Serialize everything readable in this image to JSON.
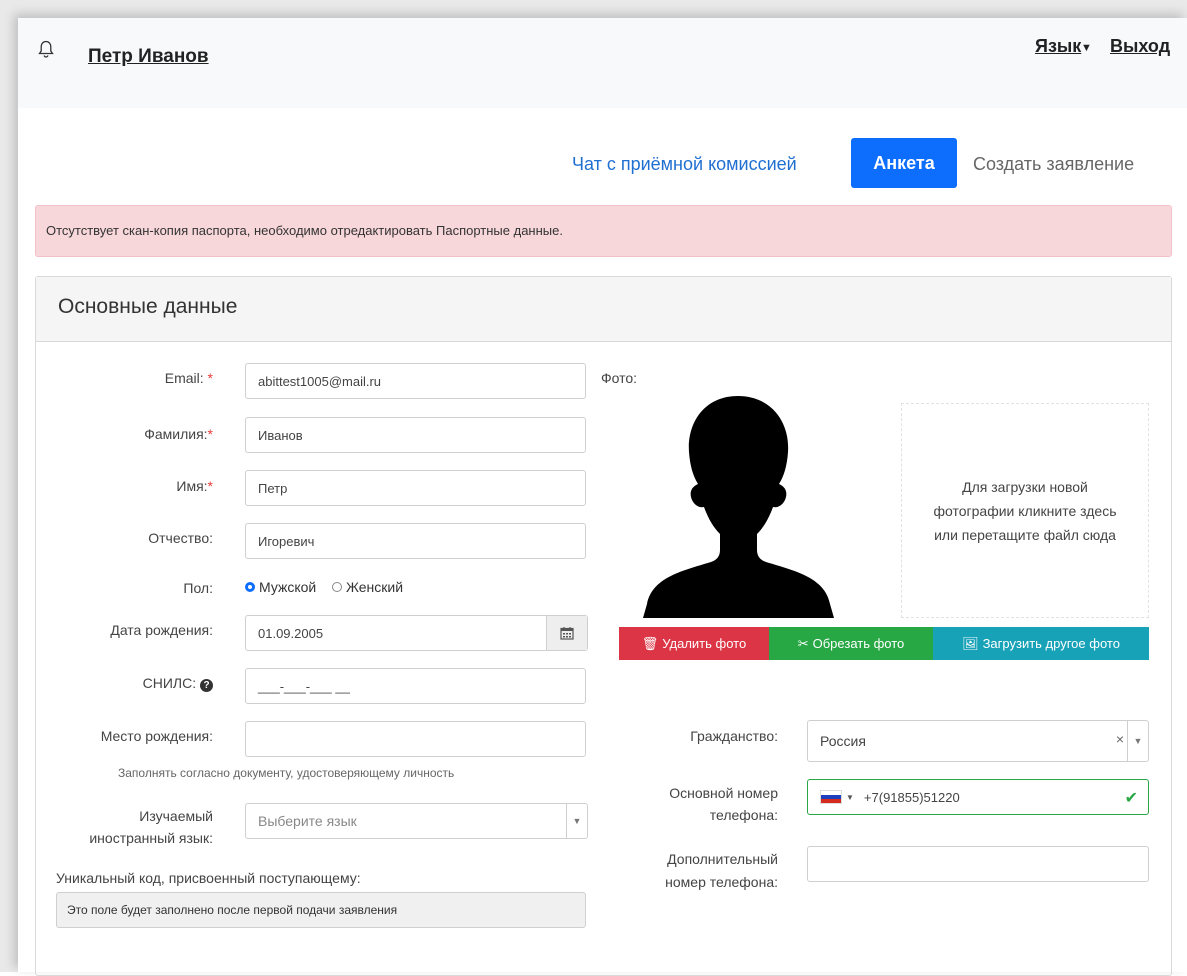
{
  "header": {
    "user_name": "Петр Иванов",
    "language_label": "Язык",
    "logout_label": "Выход"
  },
  "nav": {
    "chat_label": "Чат с приёмной комиссией",
    "anketa_label": "Анкета",
    "create_label": "Создать заявление"
  },
  "alert": {
    "text": "Отсутствует скан-копия паспорта, необходимо отредактировать Паспортные данные."
  },
  "panel": {
    "title": "Основные данные"
  },
  "form": {
    "email_label": "Email:",
    "email_value": "abittest1005@mail.ru",
    "surname_label": "Фамилия:",
    "surname_value": "Иванов",
    "name_label": "Имя:",
    "name_value": "Петр",
    "patronymic_label": "Отчество:",
    "patronymic_value": "Игоревич",
    "gender_label": "Пол:",
    "gender_male": "Мужской",
    "gender_female": "Женский",
    "birthdate_label": "Дата рождения:",
    "birthdate_value": "01.09.2005",
    "snils_label": "СНИЛС:",
    "snils_value": "___-___-___ __",
    "birthplace_label": "Место рождения:",
    "birthplace_value": "",
    "birthplace_hint": "Заполнять согласно документу, удостоверяющему личность",
    "language_label_1": "Изучаемый",
    "language_label_2": "иностранный язык:",
    "language_placeholder": "Выберите язык",
    "unique_code_label": "Уникальный код, присвоенный поступающему:",
    "unique_code_value": "Это поле будет заполнено после первой подачи заявления",
    "required_mark": "*"
  },
  "photo": {
    "label": "Фото:",
    "dropzone_line1": "Для загрузки новой",
    "dropzone_line2": "фотографии кликните здесь",
    "dropzone_line3": "или перетащите файл сюда",
    "delete_label": "Удалить фото",
    "crop_label": "Обрезать фото",
    "upload_label": "Загрузить другое фото"
  },
  "contacts": {
    "citizenship_label": "Гражданство:",
    "citizenship_value": "Россия",
    "phone_label_1": "Основной номер",
    "phone_label_2": "телефона:",
    "phone_value": "+7(91855)51220",
    "extra_phone_label_1": "Дополнительный",
    "extra_phone_label_2": "номер телефона:",
    "extra_phone_value": ""
  }
}
